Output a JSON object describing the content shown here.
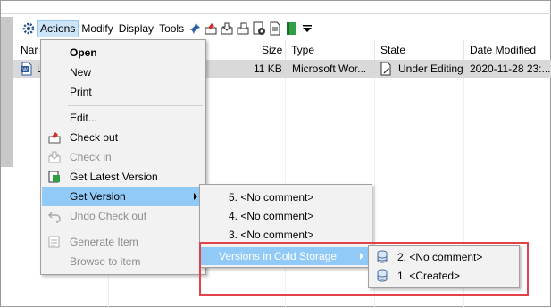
{
  "toolbar": {
    "menus": [
      "Actions",
      "Modify",
      "Display",
      "Tools"
    ],
    "icons": [
      "settings-gear-icon",
      "pin-icon",
      "check-out-icon",
      "check-in-icon",
      "get-latest-icon",
      "version-eye-icon",
      "document-icon",
      "green-book-icon",
      "dropdown-triangle-icon"
    ]
  },
  "columns": {
    "name": "Nar",
    "size": "Size",
    "type": "Type",
    "state": "State",
    "date_modified": "Date Modified"
  },
  "row": {
    "name": "L",
    "size": "11 KB",
    "type": "Microsoft Wor...",
    "state": "Under Editing",
    "date": "2020-11-28 23:..."
  },
  "actions_menu": {
    "open": "Open",
    "new": "New",
    "print": "Print",
    "edit": "Edit...",
    "check_out": "Check out",
    "check_in": "Check in",
    "get_latest": "Get Latest Version",
    "get_version": "Get Version",
    "undo_check_out": "Undo Check out",
    "generate_item": "Generate Item",
    "browse_to_item": "Browse to item"
  },
  "version_menu": {
    "items": [
      "5. <No comment>",
      "4. <No comment>",
      "3. <No comment>"
    ],
    "cold_storage": "Versions in Cold Storage"
  },
  "cold_menu": {
    "items": [
      "2. <No comment>",
      "1. <Created>"
    ]
  },
  "colors": {
    "highlight": "#91c9f7",
    "active_menu": "#cce4f7",
    "red_box": "#e0434a",
    "selection_row": "#d9d9d9"
  }
}
